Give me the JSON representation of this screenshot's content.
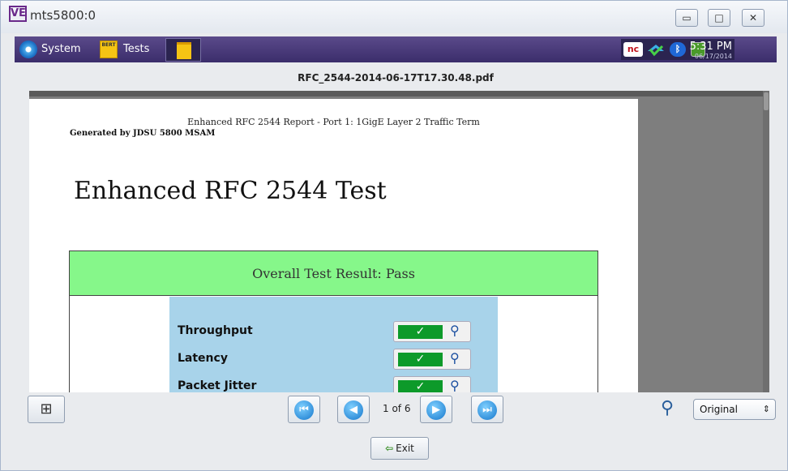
{
  "window": {
    "logo": "VE",
    "title": "mts5800:0",
    "controls": {
      "minimize": "▭",
      "maximize": "□",
      "close": "✕"
    }
  },
  "appbar": {
    "system_label": "System",
    "tests_label": "Tests",
    "bert_badge": "BERT",
    "status": {
      "nc": "nc",
      "time": "5:31 PM",
      "date": "06/17/2014"
    },
    "icons": [
      "gear-icon",
      "bert-icon",
      "document-icon",
      "nc-icon",
      "network-icon",
      "bluetooth-icon",
      "battery-icon"
    ]
  },
  "file": {
    "name": "RFC_2544-2014-06-17T17.30.48.pdf"
  },
  "report": {
    "header": "Enhanced RFC 2544 Report - Port 1: 1GigE Layer 2 Traffic Term",
    "generated_by": "Generated by JDSU 5800 MSAM",
    "title": "Enhanced RFC 2544 Test",
    "overall_result": "Overall Test Result: Pass",
    "results": [
      {
        "label": "Throughput",
        "status": "✓",
        "icon": "magnifier-icon"
      },
      {
        "label": "Latency",
        "status": "✓",
        "icon": "magnifier-icon"
      },
      {
        "label": "Packet Jitter",
        "status": "✓",
        "icon": "magnifier-icon"
      }
    ],
    "colors": {
      "pass_bar": "#86f78a",
      "panel": "#a8d3ea",
      "check": "#0d9a2a"
    }
  },
  "toolbar": {
    "page_indicator": "1 of 6",
    "first_icon": "first-page-icon",
    "prev_icon": "previous-page-icon",
    "next_icon": "next-page-icon",
    "last_icon": "last-page-icon",
    "zoom_value": "Original",
    "exit_label": "Exit"
  }
}
